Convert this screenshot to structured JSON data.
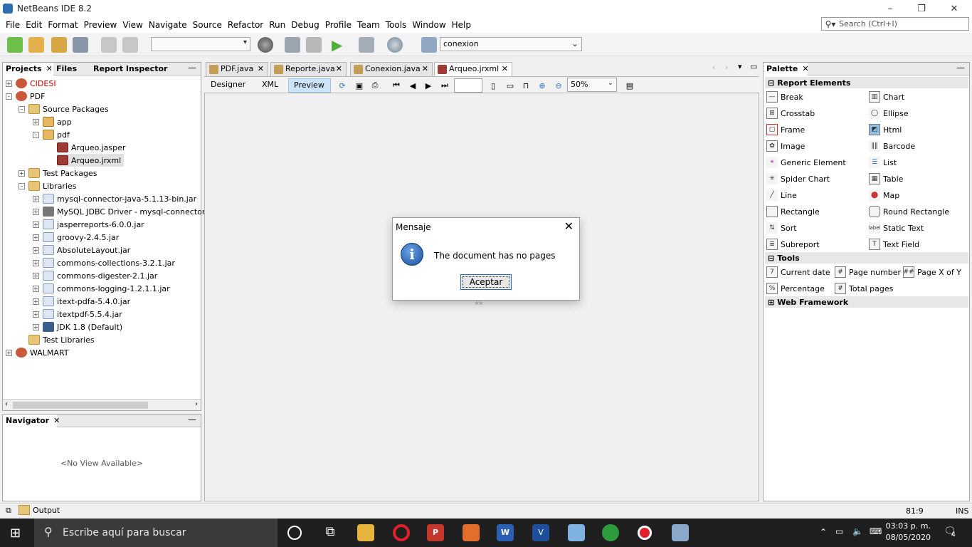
{
  "window": {
    "title": "NetBeans IDE 8.2",
    "minimize": "–",
    "maximize": "❐",
    "close": "✕"
  },
  "menu": [
    "File",
    "Edit",
    "Format",
    "Preview",
    "View",
    "Navigate",
    "Source",
    "Refactor",
    "Run",
    "Debug",
    "Profile",
    "Team",
    "Tools",
    "Window",
    "Help"
  ],
  "search": {
    "placeholder": "Search (Ctrl+I)"
  },
  "toolbar": {
    "config_value": "",
    "connection_value": "conexion"
  },
  "left_panel": {
    "tabs": [
      "Projects",
      "Files",
      "Report Inspector"
    ],
    "tree": [
      {
        "label": "CIDESI",
        "exp": "+"
      },
      {
        "label": "PDF",
        "exp": "–"
      },
      {
        "label": "Source Packages",
        "exp": "–"
      },
      {
        "label": "app",
        "exp": "+"
      },
      {
        "label": "pdf",
        "exp": "–"
      },
      {
        "label": "Arqueo.jasper",
        "exp": ""
      },
      {
        "label": "Arqueo.jrxml",
        "exp": ""
      },
      {
        "label": "Test Packages",
        "exp": "+"
      },
      {
        "label": "Libraries",
        "exp": "–"
      },
      {
        "label": "mysql-connector-java-5.1.13-bin.jar",
        "exp": "+"
      },
      {
        "label": "MySQL JDBC Driver - mysql-connector-jav",
        "exp": "+"
      },
      {
        "label": "jasperreports-6.0.0.jar",
        "exp": "+"
      },
      {
        "label": "groovy-2.4.5.jar",
        "exp": "+"
      },
      {
        "label": "AbsoluteLayout.jar",
        "exp": "+"
      },
      {
        "label": "commons-collections-3.2.1.jar",
        "exp": "+"
      },
      {
        "label": "commons-digester-2.1.jar",
        "exp": "+"
      },
      {
        "label": "commons-logging-1.2.1.1.jar",
        "exp": "+"
      },
      {
        "label": "itext-pdfa-5.4.0.jar",
        "exp": "+"
      },
      {
        "label": "itextpdf-5.5.4.jar",
        "exp": "+"
      },
      {
        "label": "JDK 1.8 (Default)",
        "exp": "+"
      },
      {
        "label": "Test Libraries",
        "exp": ""
      },
      {
        "label": "WALMART",
        "exp": "+"
      }
    ]
  },
  "navigator": {
    "tab": "Navigator",
    "empty": "<No View Available>"
  },
  "editor": {
    "tabs": [
      "PDF.java",
      "Reporte.java",
      "Conexion.java",
      "Arqueo.jrxml"
    ],
    "views": [
      "Designer",
      "XML",
      "Preview"
    ],
    "page_field": "",
    "zoom": "50%"
  },
  "dialog": {
    "title": "Mensaje",
    "message": "The document has no pages",
    "ok": "Aceptar"
  },
  "palette": {
    "tab": "Palette",
    "sections": {
      "report_elements": "Report Elements",
      "tools": "Tools",
      "web_framework": "Web Framework"
    },
    "report_elements": [
      [
        "Break",
        "Chart"
      ],
      [
        "Crosstab",
        "Ellipse"
      ],
      [
        "Frame",
        "Html"
      ],
      [
        "Image",
        "Barcode"
      ],
      [
        "Generic Element",
        "List"
      ],
      [
        "Spider Chart",
        "Table"
      ],
      [
        "Line",
        "Map"
      ],
      [
        "Rectangle",
        "Round Rectangle"
      ],
      [
        "Sort",
        "Static Text"
      ],
      [
        "Subreport",
        "Text Field"
      ]
    ],
    "tools": [
      [
        "Current date",
        "Page number",
        "Page X of Y"
      ],
      [
        "Percentage",
        "Total pages"
      ]
    ]
  },
  "statusbar": {
    "output": "Output",
    "position": "81:9",
    "mode": "INS"
  },
  "taskbar": {
    "search": "Escribe aquí para buscar",
    "time": "03:03 p. m.",
    "date": "08/05/2020",
    "notifications": "4"
  },
  "colors": {
    "accent": "#2a6bc2",
    "taskbar": "#1f1f1f",
    "project_red": "#d00000"
  }
}
